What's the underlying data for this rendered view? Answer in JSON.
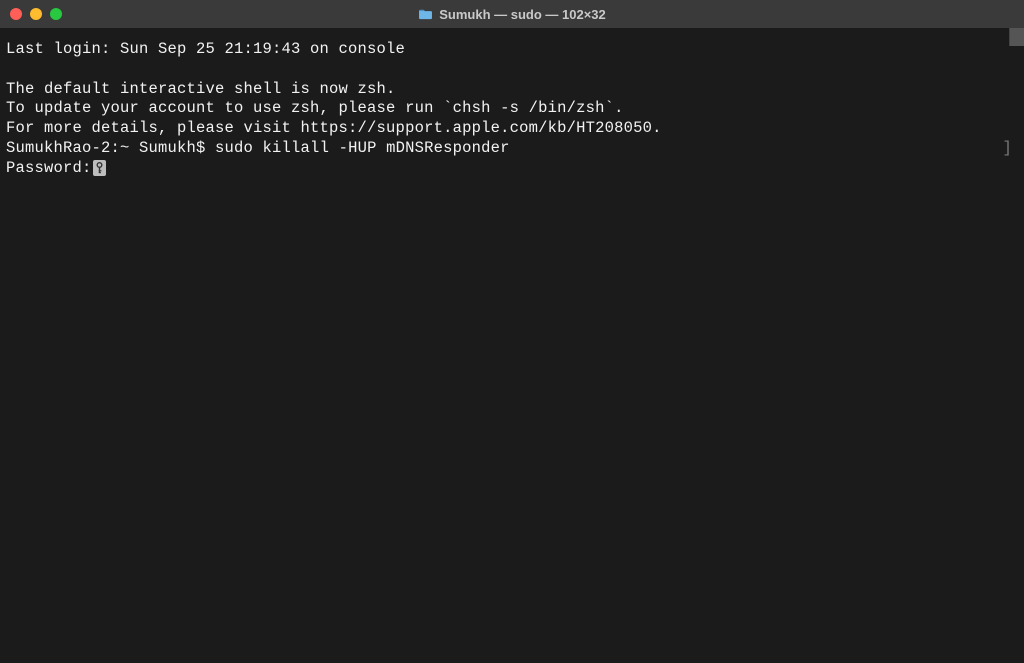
{
  "window": {
    "title": "Sumukh — sudo — 102×32"
  },
  "terminal": {
    "last_login": "Last login: Sun Sep 25 21:19:43 on console",
    "zsh_notice_1": "The default interactive shell is now zsh.",
    "zsh_notice_2": "To update your account to use zsh, please run `chsh -s /bin/zsh`.",
    "zsh_notice_3": "For more details, please visit https://support.apple.com/kb/HT208050.",
    "prompt_host": "SumukhRao-2:~ Sumukh$ ",
    "command": "sudo killall -HUP mDNSResponder",
    "password_label": "Password:",
    "right_bracket": "]"
  }
}
